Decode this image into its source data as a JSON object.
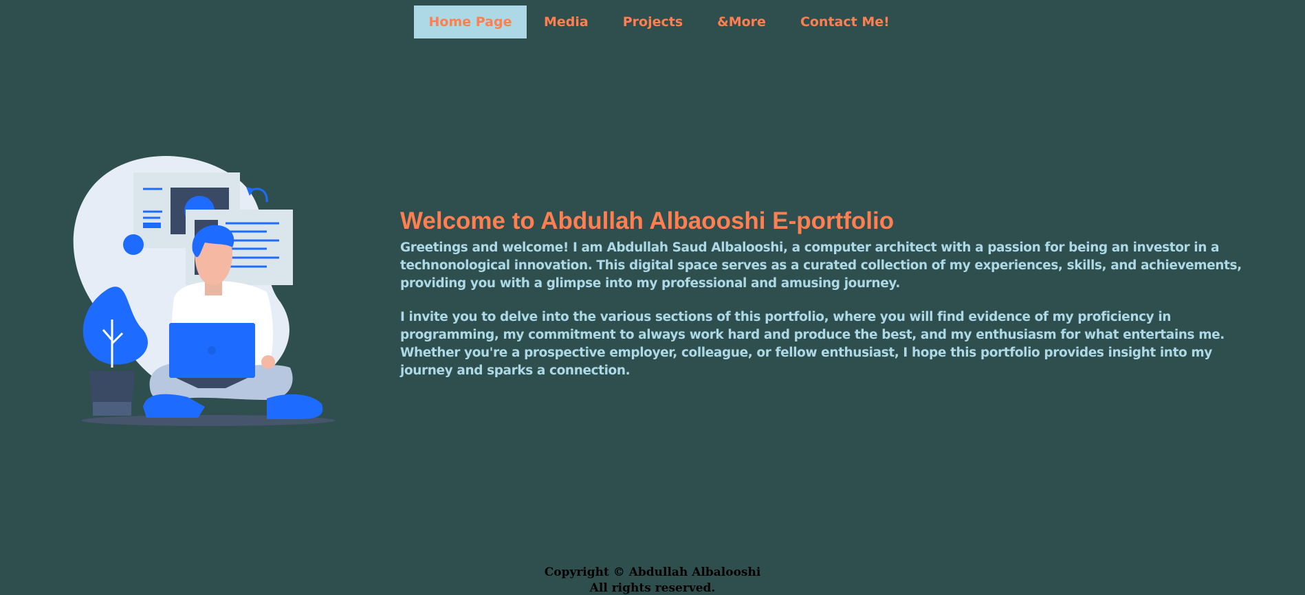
{
  "nav": {
    "items": [
      {
        "label": "Home Page",
        "active": true
      },
      {
        "label": "Media"
      },
      {
        "label": "Projects"
      },
      {
        "label": "&More"
      },
      {
        "label": "Contact Me!"
      }
    ]
  },
  "hero": {
    "illustration": "person-with-laptop-icon",
    "title": "Welcome to Abdullah Albaooshi E-portfolio",
    "paragraphs": [
      "Greetings and welcome! I am Abdullah Saud Albalooshi, a computer architect with a passion for being an investor in a technonological innovation. This digital space serves as a curated collection of my experiences, skills, and achievements, providing you with a glimpse into my professional and amusing journey.",
      "I invite you to delve into the various sections of this portfolio, where you will find evidence of my proficiency in programming, my commitment to always work hard and produce the best, and my enthusiasm for what entertains me. Whether you're a prospective employer, colleague, or fellow enthusiast, I hope this portfolio provides insight into my journey and sparks a connection."
    ]
  },
  "footer": {
    "copyright": "Copyright © Abdullah Albalooshi",
    "rights": "All rights reserved."
  },
  "colors": {
    "background": "#2f4f4f",
    "accent": "#ff7f50",
    "text": "#add8e6",
    "nav_active_bg": "#add8e6",
    "illustration_blue": "#1e6bff"
  }
}
